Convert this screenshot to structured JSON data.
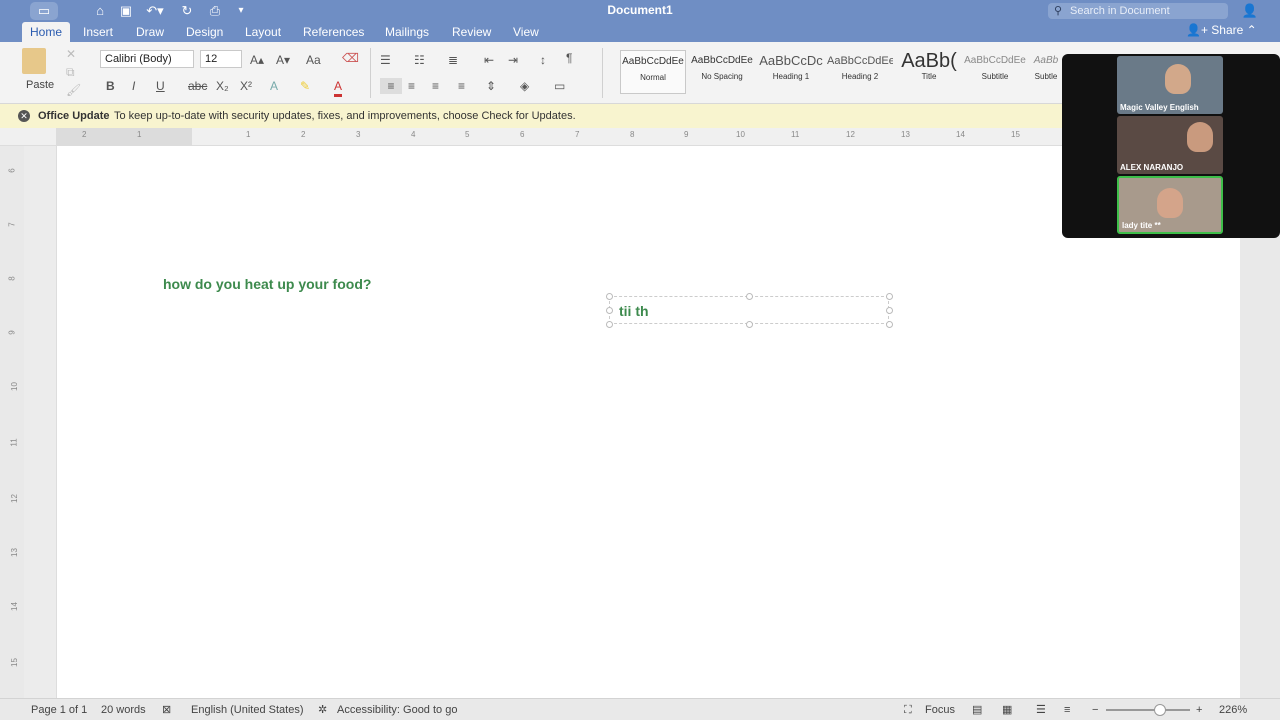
{
  "titlebar": {
    "document_title": "Document1",
    "search_placeholder": "Search in Document",
    "icons": [
      "sidebar-icon",
      "home-icon",
      "save-icon",
      "undo-icon",
      "redo-icon",
      "print-icon",
      "customize-icon",
      "account-icon"
    ]
  },
  "tabs": {
    "items": [
      "Home",
      "Insert",
      "Draw",
      "Design",
      "Layout",
      "References",
      "Mailings",
      "Review",
      "View"
    ],
    "active": "Home",
    "share_label": "Share"
  },
  "ribbon": {
    "paste_label": "Paste",
    "font_name": "Calibri (Body)",
    "font_size": "12",
    "styles": [
      {
        "sample": "AaBbCcDdEe",
        "name": "Normal"
      },
      {
        "sample": "AaBbCcDdEe",
        "name": "No Spacing"
      },
      {
        "sample": "AaBbCcDc",
        "name": "Heading 1"
      },
      {
        "sample": "AaBbCcDdEe",
        "name": "Heading 2"
      },
      {
        "sample": "AaBb(",
        "name": "Title"
      },
      {
        "sample": "AaBbCcDdEe",
        "name": "Subtitle"
      },
      {
        "sample": "AaBb",
        "name": "Subtle"
      }
    ]
  },
  "update_bar": {
    "title": "Office Update",
    "message": "To keep up-to-date with security updates, fixes, and improvements, choose Check for Updates."
  },
  "ruler": {
    "h_numbers": [
      "2",
      "1",
      "1",
      "2",
      "3",
      "4",
      "5",
      "6",
      "7",
      "8",
      "9",
      "10",
      "11",
      "12",
      "13",
      "14",
      "15"
    ],
    "v_numbers": [
      "6",
      "7",
      "8",
      "9",
      "10",
      "11",
      "12",
      "13",
      "14",
      "15"
    ]
  },
  "document": {
    "line1": "how do you heat up your food?",
    "textbox": "tii th",
    "text_color": "#3d8a4d"
  },
  "video": {
    "participants": [
      "Magic Valley English",
      "ALEX NARANJO",
      "lady tite **"
    ],
    "active_speaker": "lady tite **"
  },
  "status": {
    "page": "Page 1 of 1",
    "words": "20 words",
    "language": "English (United States)",
    "accessibility": "Accessibility: Good to go",
    "focus": "Focus",
    "zoom": "226%",
    "zoom_percent": 226
  }
}
